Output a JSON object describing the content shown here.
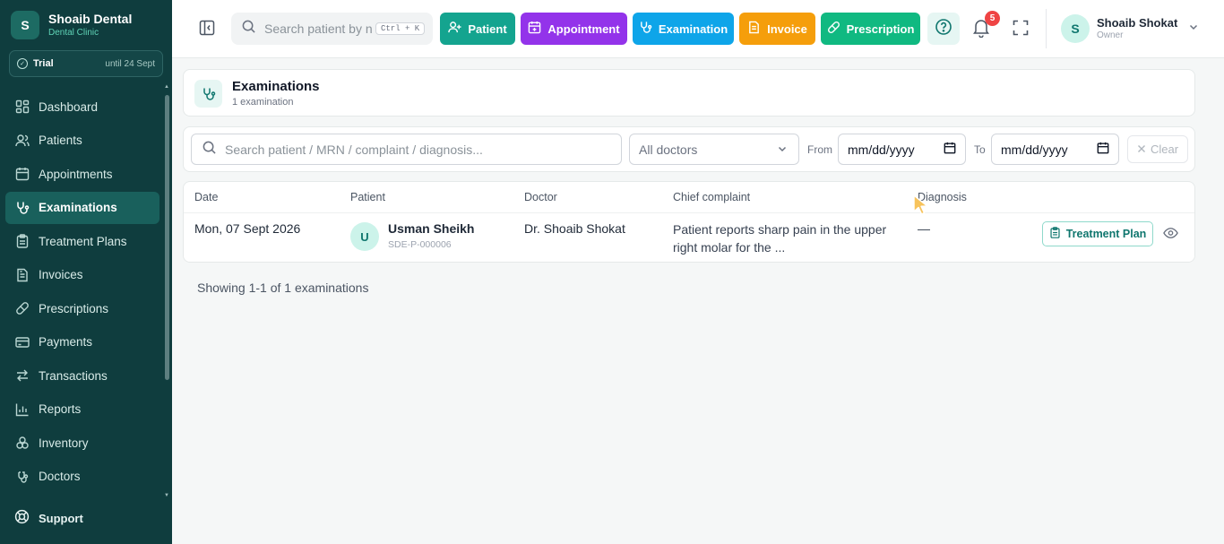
{
  "brand": {
    "avatar": "S",
    "name": "Shoaib Dental",
    "subtitle": "Dental Clinic"
  },
  "trial": {
    "label": "Trial",
    "until": "until 24 Sept"
  },
  "sidebar": {
    "items": [
      {
        "label": "Dashboard",
        "icon": "dashboard-icon"
      },
      {
        "label": "Patients",
        "icon": "users-icon"
      },
      {
        "label": "Appointments",
        "icon": "calendar-icon"
      },
      {
        "label": "Examinations",
        "icon": "stethoscope-icon",
        "active": true
      },
      {
        "label": "Treatment Plans",
        "icon": "clipboard-icon"
      },
      {
        "label": "Invoices",
        "icon": "document-icon"
      },
      {
        "label": "Prescriptions",
        "icon": "pill-icon"
      },
      {
        "label": "Payments",
        "icon": "credit-card-icon"
      },
      {
        "label": "Transactions",
        "icon": "arrows-icon"
      },
      {
        "label": "Reports",
        "icon": "bar-chart-icon"
      },
      {
        "label": "Inventory",
        "icon": "boxes-icon"
      },
      {
        "label": "Doctors",
        "icon": "doctor-icon"
      }
    ],
    "support_label": "Support"
  },
  "topbar": {
    "search_placeholder": "Search patient by name, MRN...",
    "search_shortcut": "Ctrl + K",
    "quick_actions": {
      "patient": "Patient",
      "appointment": "Appointment",
      "examination": "Examination",
      "invoice": "Invoice",
      "prescription": "Prescription"
    },
    "notification_count": "5",
    "user": {
      "initial": "S",
      "name": "Shoaib Shokat",
      "role": "Owner"
    }
  },
  "page": {
    "title": "Examinations",
    "subtitle": "1 examination"
  },
  "filters": {
    "search_placeholder": "Search patient / MRN / complaint / diagnosis...",
    "doctor_select": "All doctors",
    "from_label": "From",
    "to_label": "To",
    "from_value": "mm/dd/yyyy",
    "to_value": "mm/dd/yyyy",
    "clear_label": "Clear"
  },
  "table": {
    "columns": [
      "Date",
      "Patient",
      "Doctor",
      "Chief complaint",
      "Diagnosis"
    ],
    "rows": [
      {
        "date": "Mon, 07 Sept 2026",
        "patient_initial": "U",
        "patient_name": "Usman Sheikh",
        "patient_mrn": "SDE-P-000006",
        "doctor": "Dr. Shoaib Shokat",
        "complaint": "Patient reports sharp pain in the upper right molar for the ...",
        "diagnosis": "—",
        "action_label": "Treatment Plan"
      }
    ]
  },
  "footer": {
    "showing": "Showing 1-1 of 1 examinations"
  },
  "colors": {
    "sidebar_bg": "#0f3d3e",
    "sidebar_active": "#19605c",
    "patient_btn": "#14a48f",
    "appointment_btn": "#9333ea",
    "examination_btn": "#0ea5e9",
    "invoice_btn": "#f59e0b",
    "prescription_btn": "#10b981",
    "notification_badge": "#ef4444"
  }
}
